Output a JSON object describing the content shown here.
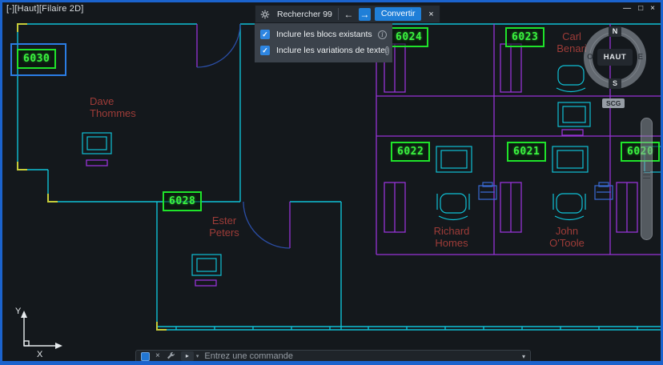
{
  "viewport": {
    "label": "[-][Haut][Filaire 2D]"
  },
  "window_controls": {
    "minimize": "—",
    "maximize": "□",
    "close": "×"
  },
  "icons": {
    "check": "✓",
    "back": "←",
    "forward": "→",
    "close": "×",
    "info": "i",
    "prompt": "▸",
    "caret": "▾",
    "chevron": "▾"
  },
  "find_toolbar": {
    "search_text": "Rechercher 99",
    "convert_label": "Convertir",
    "options": [
      {
        "label": "Inclure les blocs existants",
        "checked": true
      },
      {
        "label": "Inclure les variations de texte",
        "checked": true
      }
    ]
  },
  "navigation": {
    "compass": {
      "n": "N",
      "w": "O",
      "e": "E",
      "s": "S",
      "center": "HAUT"
    },
    "ucs_chip": "SCG"
  },
  "command_bar": {
    "placeholder": "Entrez une commande"
  },
  "axes": {
    "x": "X",
    "y": "Y"
  },
  "plan": {
    "tags": [
      {
        "text": "6030",
        "selected": true
      },
      {
        "text": "6024"
      },
      {
        "text": "6023"
      },
      {
        "text": "6022"
      },
      {
        "text": "6021"
      },
      {
        "text": "6020"
      },
      {
        "text": "6028"
      }
    ],
    "names": [
      {
        "line1": "Dave",
        "line2": "Thommes"
      },
      {
        "line1": "Ester",
        "line2": "Peters"
      },
      {
        "line1": "Richard",
        "line2": "Homes"
      },
      {
        "line1": "John",
        "line2": "O'Toole"
      },
      {
        "line1": "Carl",
        "line2": "Benari"
      }
    ]
  },
  "colors": {
    "accent_blue": "#1f7fd8",
    "highlight_green": "#1fe32a",
    "selection_blue": "#2b7de4",
    "wall_cyan": "#0fc0d5",
    "wall_purple": "#9633d6",
    "name_red": "#9e3c38"
  }
}
